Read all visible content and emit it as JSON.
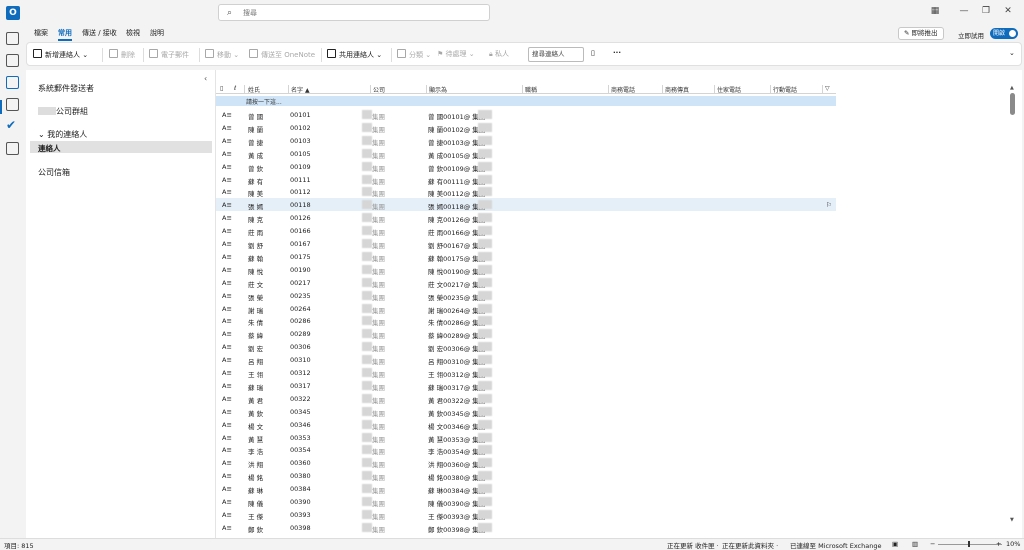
{
  "titlebar": {
    "app_logo": "O",
    "search_placeholder": "搜尋"
  },
  "menu": {
    "file": "檔案",
    "home": "常用",
    "send_receive": "傳送 / 接收",
    "view": "檢視",
    "help": "說明"
  },
  "top_right": {
    "coming_soon": "即將推出",
    "try_now": "立即試用",
    "toggle": "開啟"
  },
  "ribbon": {
    "new_contact": "新增連絡人",
    "delete": "刪除",
    "email": "電子郵件",
    "move": "移動",
    "onenote": "傳送至 OneNote",
    "share_contacts": "共用連絡人",
    "categorize": "分類",
    "follow_up": "待處理",
    "private": "私人",
    "search_people": "搜尋連絡人",
    "more": "···"
  },
  "folders": {
    "suggested": "系統郵件發送者",
    "company_group": "公司群組",
    "my_contacts": "我的連絡人",
    "contacts": "連絡人",
    "company_mailbox": "公司信箱"
  },
  "grid": {
    "headers": [
      "姓氏",
      "名字",
      "公司",
      "顯示為",
      "職稱",
      "商務電話",
      "商務傳真",
      "住家電話",
      "行動電話"
    ],
    "new_row": "請按一下這...",
    "company_text": "集團",
    "rows": [
      {
        "icon": "A≡",
        "name": "曾  國",
        "num": "00101",
        "mail": "曾  國00101@      集團"
      },
      {
        "icon": "A≡",
        "name": "陳  蘭",
        "num": "00102",
        "mail": "陳  蘭00102@      集團"
      },
      {
        "icon": "A≡",
        "name": "曾  捷",
        "num": "00103",
        "mail": "曾  捷00103@      集團"
      },
      {
        "icon": "A≡",
        "name": "黃  成",
        "num": "00105",
        "mail": "黃  成00105@      集團"
      },
      {
        "icon": "A≡",
        "name": "曾  欽",
        "num": "00109",
        "mail": "曾  欽00109@      集團"
      },
      {
        "icon": "A≡",
        "name": "蘇  有",
        "num": "00111",
        "mail": "蘇  有00111@      集團"
      },
      {
        "icon": "A≡",
        "name": "陳  美",
        "num": "00112",
        "mail": "陳  美00112@      集團"
      },
      {
        "icon": "A≡",
        "name": "張  嫣",
        "num": "00118",
        "mail": "張  嫣00118@      集團"
      },
      {
        "icon": "A≡",
        "name": "陳  克",
        "num": "00126",
        "mail": "陳  克00126@      集團"
      },
      {
        "icon": "A≡",
        "name": "莊  雨",
        "num": "00166",
        "mail": "莊  雨00166@      集團"
      },
      {
        "icon": "A≡",
        "name": "劉  舒",
        "num": "00167",
        "mail": "劉  舒00167@      集團"
      },
      {
        "icon": "A≡",
        "name": "蘇  翰",
        "num": "00175",
        "mail": "蘇  翰00175@      集團"
      },
      {
        "icon": "A≡",
        "name": "陳  悅",
        "num": "00190",
        "mail": "陳  悅00190@      集團"
      },
      {
        "icon": "A≡",
        "name": "莊  文",
        "num": "00217",
        "mail": "莊  文00217@      集團"
      },
      {
        "icon": "A≡",
        "name": "張  榮",
        "num": "00235",
        "mail": "張  榮00235@      集團"
      },
      {
        "icon": "A≡",
        "name": "謝  瑞",
        "num": "00264",
        "mail": "謝  瑞00264@      集團"
      },
      {
        "icon": "A≡",
        "name": "朱  倩",
        "num": "00286",
        "mail": "朱  倩00286@      集團"
      },
      {
        "icon": "A≡",
        "name": "蔡  緯",
        "num": "00289",
        "mail": "蔡  緯00289@      集團"
      },
      {
        "icon": "A≡",
        "name": "劉  宏",
        "num": "00306",
        "mail": "劉  宏00306@      集團"
      },
      {
        "icon": "A≡",
        "name": "呂  翔",
        "num": "00310",
        "mail": "呂  翔00310@      集團"
      },
      {
        "icon": "A≡",
        "name": "王  翎",
        "num": "00312",
        "mail": "王  翎00312@      集團"
      },
      {
        "icon": "A≡",
        "name": "蘇  瑞",
        "num": "00317",
        "mail": "蘇  瑞00317@      集團"
      },
      {
        "icon": "A≡",
        "name": "黃  君",
        "num": "00322",
        "mail": "黃  君00322@      集團"
      },
      {
        "icon": "A≡",
        "name": "黃  欽",
        "num": "00345",
        "mail": "黃  欽00345@      集團"
      },
      {
        "icon": "A≡",
        "name": "楊  文",
        "num": "00346",
        "mail": "楊  文00346@      集團"
      },
      {
        "icon": "A≡",
        "name": "黃  慧",
        "num": "00353",
        "mail": "黃  慧00353@      集團"
      },
      {
        "icon": "A≡",
        "name": "李  浩",
        "num": "00354",
        "mail": "李  浩00354@      集團"
      },
      {
        "icon": "A≡",
        "name": "洪  翔",
        "num": "00360",
        "mail": "洪  翔00360@      集團"
      },
      {
        "icon": "A≡",
        "name": "楊  銘",
        "num": "00380",
        "mail": "楊  銘00380@      集團"
      },
      {
        "icon": "A≡",
        "name": "蘇  琳",
        "num": "00384",
        "mail": "蘇  琳00384@      集團"
      },
      {
        "icon": "A≡",
        "name": "陳  儀",
        "num": "00390",
        "mail": "陳  儀00390@      集團"
      },
      {
        "icon": "A≡",
        "name": "王  傑",
        "num": "00393",
        "mail": "王  傑00393@      集團"
      },
      {
        "icon": "A≡",
        "name": "鄭  欽",
        "num": "00398",
        "mail": "鄭  欽00398@      集團"
      }
    ]
  },
  "status": {
    "items": "項目: 815",
    "updating_inbox": "正在更新 收件匣 ·",
    "updating_folder": "正在更新此資料夾 ·",
    "connected": "已連線至 Microsoft Exchange",
    "zoom": "10%"
  }
}
